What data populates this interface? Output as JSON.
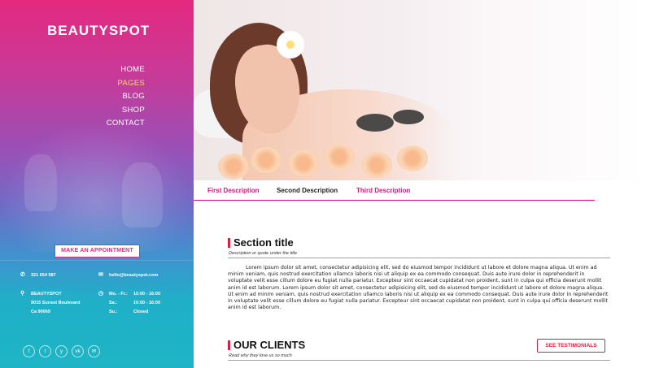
{
  "brand": {
    "logo": "BEAUTYSPOT",
    "accent": "#e0117f",
    "section_accent": "#e11b3c"
  },
  "nav": {
    "items": [
      "HOME",
      "PAGES",
      "BLOG",
      "SHOP",
      "CONTACT"
    ],
    "active": "PAGES"
  },
  "sidebar": {
    "appointment_label": "MAKE AN APPOINTMENT",
    "phone": "321 654 987",
    "email": "hello@beautyspot.com",
    "address": [
      "BEAUTYSPOT",
      "9015 Sunset Boulevard",
      "Ca 90069"
    ],
    "hours": [
      {
        "days": "Mo. - Fr.:",
        "time": "10:00 - 16:00"
      },
      {
        "days": "Sa.:",
        "time": "10:00 - 16:00"
      },
      {
        "days": "Su.:",
        "time": "Closed"
      }
    ],
    "social_icons": [
      "facebook-icon",
      "twitter-icon",
      "yelp-icon",
      "vk-icon",
      "mail-icon"
    ]
  },
  "tabs": [
    "First Description",
    "Second Description",
    "Third Description"
  ],
  "active_tab": "Second Description",
  "section": {
    "title": "Section title",
    "subtitle": "Description or quote under the title",
    "body": "Lorem ipsum dolor sit amet, consectetur adipisicing elit, sed do eiusmod tempor incididunt ut labore et dolore magna aliqua. Ut enim ad minim veniam, quis nostrud exercitation ullamco laboris nisi ut aliquip ex ea commodo consequat. Duis aute irure dolor in reprehenderit in voluptate velit esse cillum dolore eu fugiat nulla pariatur. Excepteur sint occaecat cupidatat non proident, sunt in culpa qui officia deserunt mollit anim id est laborum. Lorem ipsum dolor sit amet, consectetur adipisicing elit, sed do eiusmod tempor incididunt ut labore et dolore magna aliqua. Ut enim ad minim veniam, quis nostrud exercitation ullamco laboris nisi ut aliquip ex ea commodo consequat. Duis aute irure dolor in reprehenderit in voluptate velit esse cillum dolore eu fugiat nulla pariatur. Excepteur sint occaecat cupidatat non proident, sunt in culpa qui officia deserunt mollit anim id est laborum."
  },
  "clients": {
    "title": "OUR CLIENTS",
    "subtitle": "Read why they love us so much",
    "button_label": "SEE TESTIMONIALS"
  }
}
